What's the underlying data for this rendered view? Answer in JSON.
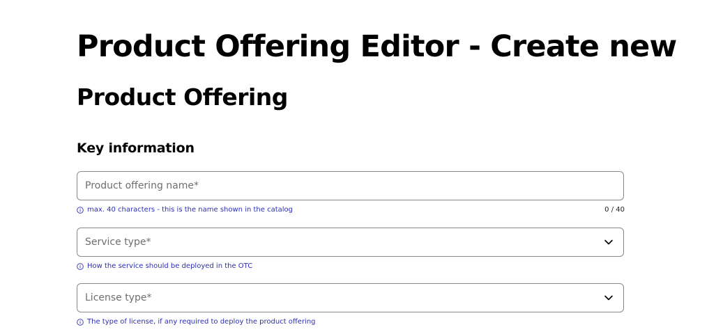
{
  "page": {
    "title": "Product Offering Editor - Create new",
    "subtitle": "Product Offering",
    "section_heading": "Key information"
  },
  "fields": {
    "product_offering_name": {
      "placeholder": "Product offering name*",
      "value": "",
      "helper": "max. 40 characters - this is the name shown in the catalog",
      "counter": "0 / 40"
    },
    "service_type": {
      "label": "Service type*",
      "helper": "How the service should be deployed in the OTC"
    },
    "license_type": {
      "label": "License type*",
      "helper": "The type of license, if any required to deploy the product offering"
    }
  },
  "icons": {
    "info": "info-circle-icon",
    "dropdown": "chevron-down-icon"
  },
  "colors": {
    "helper_text": "#2b2fb3",
    "border": "#8a8a8a",
    "placeholder": "#6f6f6f"
  }
}
